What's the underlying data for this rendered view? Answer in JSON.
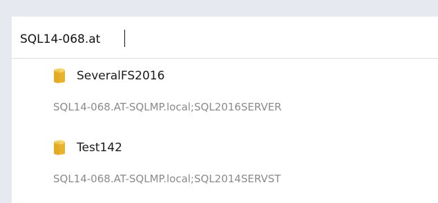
{
  "search": {
    "value": "SQL14-068.at"
  },
  "results": [
    {
      "name": "SeveralFS2016",
      "detail": "SQL14-068.AT-SQLMP.local;SQL2016SERVER",
      "icon": "database-icon"
    },
    {
      "name": "Test142",
      "detail": "SQL14-068.AT-SQLMP.local;SQL2014SERVST",
      "icon": "database-icon"
    }
  ],
  "colors": {
    "icon_fill": "#e8b32c",
    "icon_top": "#f5d46a",
    "text_primary": "#1a1a1a",
    "text_secondary": "#8a8a8a",
    "frame_bg": "#e6e9ef"
  }
}
